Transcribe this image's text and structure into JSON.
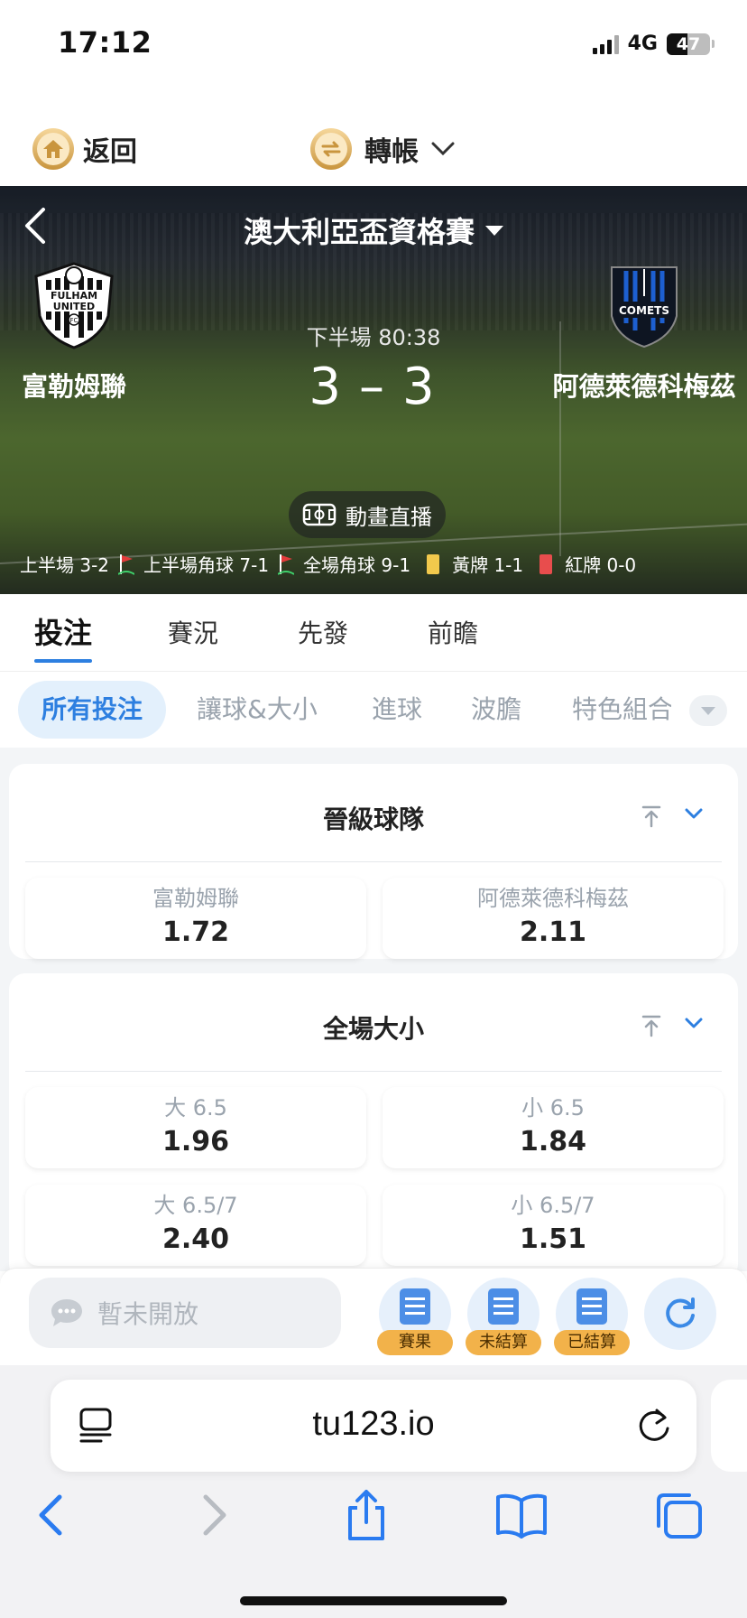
{
  "status_bar": {
    "time": "17:12",
    "network": "4G",
    "battery": "47",
    "battery_level": 0.47
  },
  "top_bar": {
    "back_label": "返回",
    "transfer_label": "轉帳"
  },
  "match": {
    "league": "澳大利亞盃資格賽",
    "period_time": "下半場 80:38",
    "home": {
      "name": "富勒姆聯",
      "score": "3",
      "logo_text": [
        "FULHAM",
        "UNITED",
        "FC"
      ]
    },
    "away": {
      "name": "阿德萊德科梅茲",
      "score": "3",
      "logo_text": "COMETS"
    },
    "score_sep": "–",
    "live_label": "動畫直播",
    "stats": {
      "first_half": "上半場 3-2",
      "first_half_corners": "上半場角球 7-1",
      "full_corners": "全場角球 9-1",
      "yellow_cards": "黃牌 1-1",
      "red_cards": "紅牌 0-0"
    }
  },
  "main_tabs": [
    "投注",
    "賽況",
    "先發",
    "前瞻"
  ],
  "sub_tabs": [
    "所有投注",
    "讓球&大小",
    "進球",
    "波膽",
    "特色組合"
  ],
  "markets": [
    {
      "title": "晉級球隊",
      "odds": [
        {
          "label": "富勒姆聯",
          "value": "1.72"
        },
        {
          "label": "阿德萊德科梅茲",
          "value": "2.11"
        }
      ]
    },
    {
      "title": "全場大小",
      "odds": [
        {
          "label": "大 6.5",
          "value": "1.96"
        },
        {
          "label": "小 6.5",
          "value": "1.84"
        },
        {
          "label": "大 6.5/7",
          "value": "2.40"
        },
        {
          "label": "小 6.5/7",
          "value": "1.51"
        }
      ]
    }
  ],
  "action_bar": {
    "chat_placeholder": "暫未開放",
    "quick": [
      "賽果",
      "未結算",
      "已結算"
    ]
  },
  "browser": {
    "url": "tu123.io"
  },
  "colors": {
    "accent": "#2d7fe0",
    "gold": "#c9953e",
    "card_yellow": "#f2c94c",
    "card_red": "#e84d4d"
  }
}
